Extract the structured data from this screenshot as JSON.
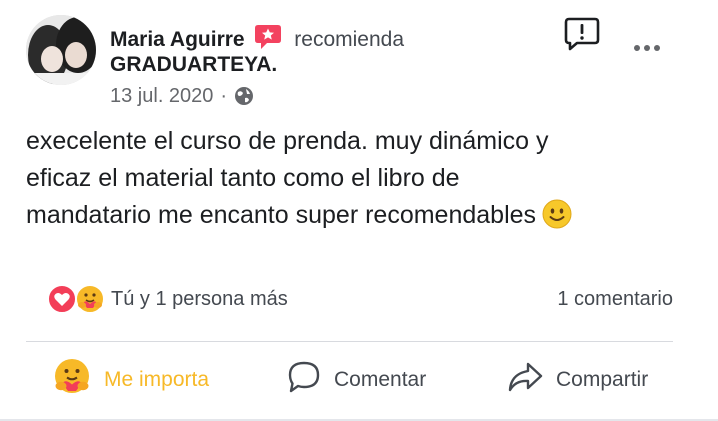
{
  "post": {
    "author": "Maria Aguirre",
    "action_word": "recomienda",
    "page_name": "GRADUARTEYA.",
    "date": "13 jul. 2020",
    "separator": "·",
    "privacy_icon": "globe-icon",
    "text": "execelente el curso de prenda. muy dinámico y\neficaz el material tanto como  el libro de\nmandatario me encanto super recomendables",
    "emoji": "slightly-smiling-face"
  },
  "reactions": {
    "icons": [
      "love-reaction-icon",
      "care-reaction-icon"
    ],
    "summary": "Tú y 1 persona más",
    "comments": "1 comentario"
  },
  "actions": {
    "like_label": "Me importa",
    "comment_label": "Comentar",
    "share_label": "Compartir"
  },
  "colors": {
    "recommend_badge": "#f3425f",
    "love": "#f33e58",
    "care": "#f7b928",
    "text": "#1c1e21",
    "secondary_text": "#65676b"
  }
}
